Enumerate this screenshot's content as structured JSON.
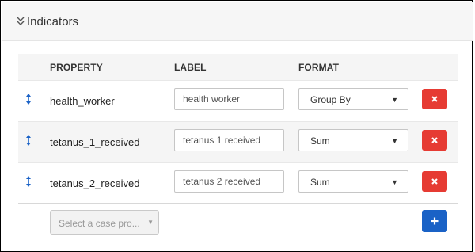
{
  "panel": {
    "title": "Indicators",
    "collapse_icon": "double-chevron-down-icon"
  },
  "table": {
    "headers": {
      "property": "PROPERTY",
      "label": "LABEL",
      "format": "FORMAT"
    },
    "rows": [
      {
        "property": "health_worker",
        "label": "health worker",
        "format": "Group By"
      },
      {
        "property": "tetanus_1_received",
        "label": "tetanus 1 received",
        "format": "Sum"
      },
      {
        "property": "tetanus_2_received",
        "label": "tetanus 2 received",
        "format": "Sum"
      }
    ]
  },
  "footer": {
    "case_select_placeholder": "Select a case pro...",
    "add_icon": "plus-icon"
  },
  "colors": {
    "delete_button": "#e63b33",
    "add_button": "#1a62c6",
    "drag_handle": "#1a62c6"
  }
}
